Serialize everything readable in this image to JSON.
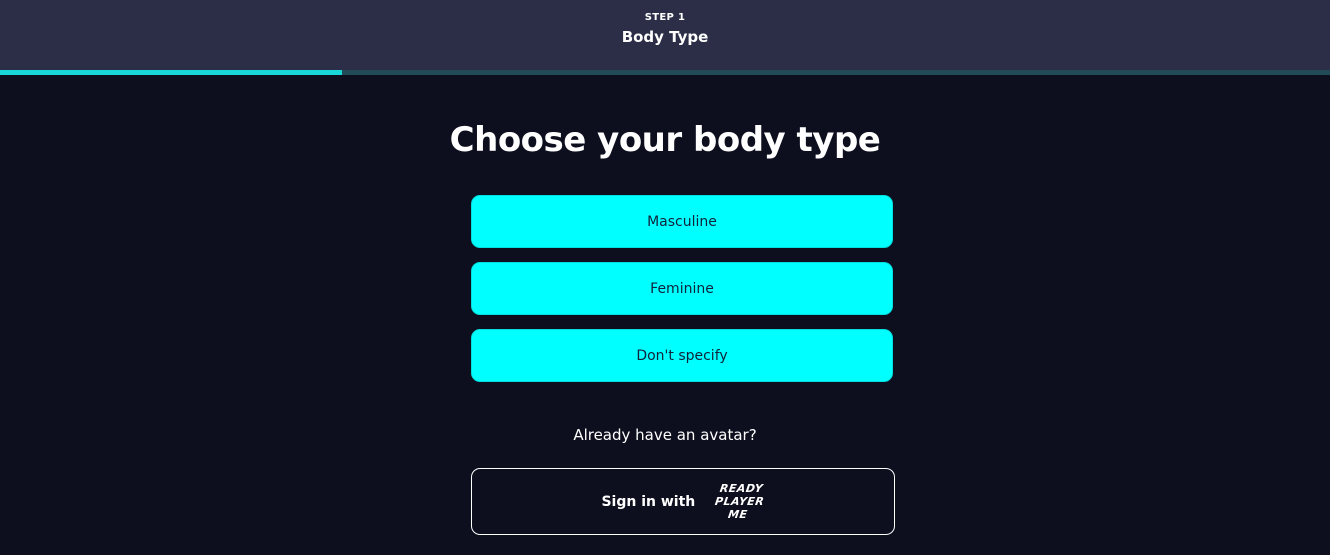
{
  "header": {
    "step_label": "STEP 1",
    "step_title": "Body Type"
  },
  "progress": {
    "fraction": 0.257
  },
  "main": {
    "title": "Choose your body type",
    "options": [
      {
        "label": "Masculine"
      },
      {
        "label": "Feminine"
      },
      {
        "label": "Don't specify"
      }
    ],
    "already_text": "Already have an avatar?",
    "signin_label": "Sign in with",
    "logo_lines": [
      "READY",
      "PLAYER",
      "ME"
    ]
  },
  "colors": {
    "background": "#0d0f1e",
    "header": "#2c2e47",
    "accent": "#00ffff",
    "progress_fill": "#19d6d8"
  }
}
